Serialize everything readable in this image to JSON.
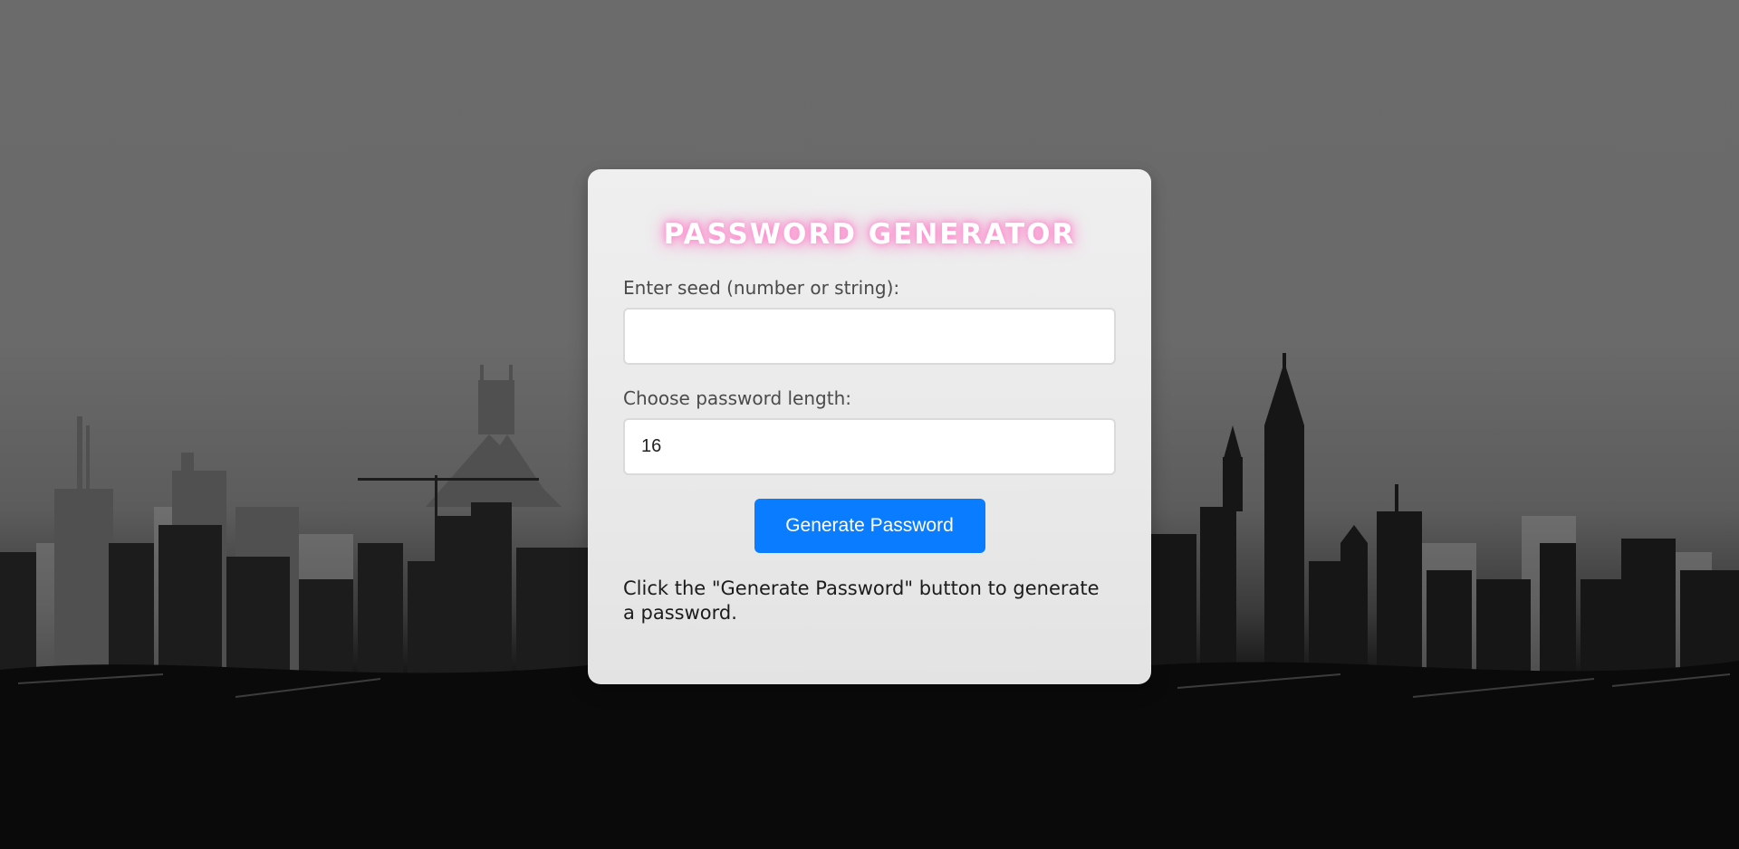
{
  "app": {
    "title": "PASSWORD GENERATOR"
  },
  "form": {
    "seed_label": "Enter seed (number or string):",
    "seed_value": "",
    "seed_placeholder": "",
    "length_label": "Choose password length:",
    "length_value": "16",
    "generate_label": "Generate Password"
  },
  "output": {
    "message": "Click the \"Generate Password\" button to generate a password."
  },
  "colors": {
    "accent": "#0a7cff",
    "title_glow": "#ff79c6",
    "card_background": "#ececec",
    "page_background": "#6a6a6a"
  }
}
